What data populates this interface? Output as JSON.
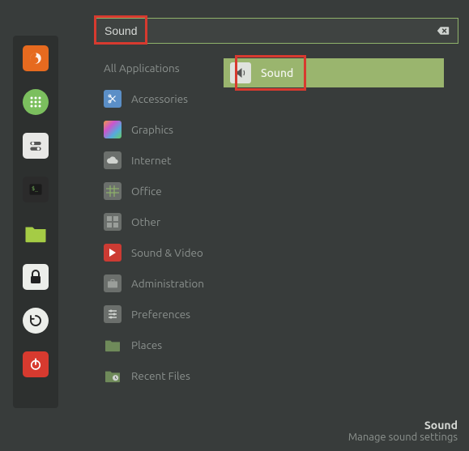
{
  "search": {
    "value": "Sound"
  },
  "categories": {
    "header": "All Applications",
    "items": [
      {
        "label": "Accessories"
      },
      {
        "label": "Graphics"
      },
      {
        "label": "Internet"
      },
      {
        "label": "Office"
      },
      {
        "label": "Other"
      },
      {
        "label": "Sound & Video"
      },
      {
        "label": "Administration"
      },
      {
        "label": "Preferences"
      },
      {
        "label": "Places"
      },
      {
        "label": "Recent Files"
      }
    ]
  },
  "results": [
    {
      "label": "Sound"
    }
  ],
  "description": {
    "title": "Sound",
    "subtitle": "Manage sound settings"
  },
  "launcher": [
    {
      "name": "firefox"
    },
    {
      "name": "apps-grid"
    },
    {
      "name": "settings-toggle"
    },
    {
      "name": "terminal"
    },
    {
      "name": "files"
    },
    {
      "name": "lock"
    },
    {
      "name": "restart"
    },
    {
      "name": "power"
    }
  ]
}
